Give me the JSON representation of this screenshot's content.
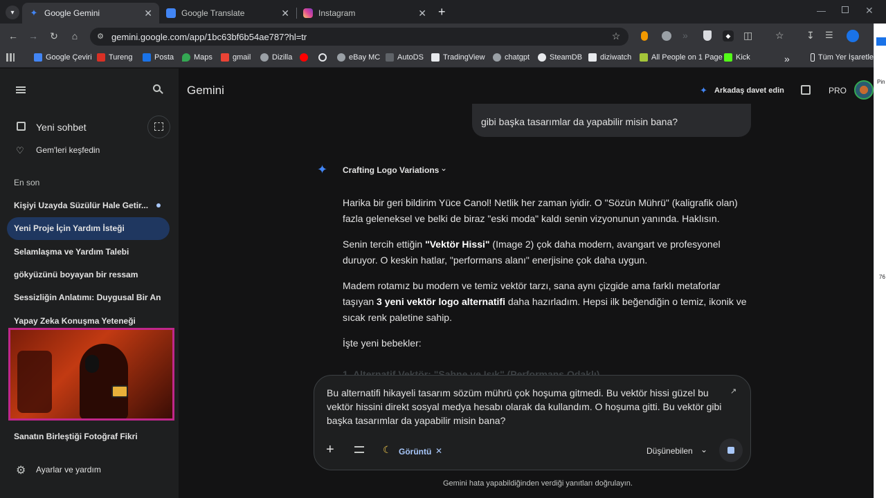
{
  "tabs": [
    {
      "label": "Google Gemini",
      "color": "#4285f4"
    },
    {
      "label": "Google Translate",
      "color": "#4285f4"
    },
    {
      "label": "Instagram",
      "color": "#e1306c"
    }
  ],
  "url": "gemini.google.com/app/1bc63bf6b54ae787?hl=tr",
  "bookmarks": [
    {
      "label": "Google Çeviri",
      "color": "#4285f4"
    },
    {
      "label": "Tureng",
      "color": "#d93025"
    },
    {
      "label": "Posta",
      "color": "#1a73e8"
    },
    {
      "label": "Maps",
      "color": "#34a853"
    },
    {
      "label": "gmail",
      "color": "#ea4335"
    },
    {
      "label": "Dizilla",
      "color": "#9aa0a6"
    },
    {
      "label": "",
      "color": "#ff0000"
    },
    {
      "label": "",
      "color": "#e8eaed"
    },
    {
      "label": "eBay MC",
      "color": "#9aa0a6"
    },
    {
      "label": "AutoDS",
      "color": "#9aa0a6"
    },
    {
      "label": "TradingView",
      "color": "#e8eaed"
    },
    {
      "label": "chatgpt",
      "color": "#9aa0a6"
    },
    {
      "label": "SteamDB",
      "color": "#e8eaed"
    },
    {
      "label": "diziwatch",
      "color": "#e8eaed"
    },
    {
      "label": "All People on 1 Page",
      "color": "#a4c639"
    },
    {
      "label": "Kick",
      "color": "#53fc18"
    }
  ],
  "bookmarks_more": "»",
  "bookmarks_folder": "Tüm Yer İşaretle",
  "sidebar": {
    "new_chat": "Yeni sohbet",
    "explore_gems": "Gem'leri keşfedin",
    "recent_heading": "En son",
    "recent": [
      "Kişiyi Uzayda Süzülür Hale Getir...",
      "Yeni Proje İçin Yardım İsteği",
      "Selamlaşma ve Yardım Talebi",
      "gökyüzünü boyayan bir ressam",
      "Sessizliğin Anlatımı: Duygusal Bir An",
      "Yapay Zeka Konuşma Yeteneği"
    ],
    "recent_after_cam": "Sanatın Birleştiği Fotoğraf Fikri",
    "settings": "Ayarlar ve yardım"
  },
  "header": {
    "title": "Gemini",
    "invite": "Arkadaş davet edin",
    "plan": "PRO"
  },
  "user_message_tail": "gibi başka tasarımlar da yapabilir misin bana?",
  "thinking_label": "Crafting Logo Variations",
  "response": {
    "p1": "Harika bir geri bildirim Yüce Canol! Netlik her zaman iyidir. O \"Sözün Mührü\" (kaligrafik olan) fazla geleneksel ve belki de biraz \"eski moda\" kaldı senin vizyonunun yanında. Haklısın.",
    "p2a": "Senin tercih ettiğin ",
    "p2b": "\"Vektör Hissi\"",
    "p2c": " (Image 2) çok daha modern, avangart ve profesyonel duruyor. O keskin hatlar, \"performans alanı\" enerjisine çok daha uygun.",
    "p3a": "Madem rotamız bu modern ve temiz vektör tarzı, sana aynı çizgide ama farklı metaforlar taşıyan ",
    "p3b": "3 yeni vektör logo alternatifi",
    "p3c": " daha hazırladım. Hepsi ilk beğendiğin o temiz, ikonik ve sıcak renk paletine sahip.",
    "p4": "İşte yeni bebekler:",
    "faded": "1. Alternatif Vektör: \"Sahne ve Işık\" (Performans Odaklı)"
  },
  "composer": {
    "text": "Bu alternatifi hikayeli tasarım sözüm mührü çok hoşuma gitmedi. Bu vektör hissi güzel bu vektör hissini direkt sosyal medya hesabı olarak da kullandım. O hoşuma gitti. Bu vektör gibi başka tasarımlar da yapabilir misin bana?",
    "chip": "Görüntü",
    "model": "Düşünebilen"
  },
  "disclaimer": "Gemini hata yapabildiğinden verdiği yanıtları doğrulayın.",
  "edge_labels": [
    "Pin",
    "76"
  ]
}
